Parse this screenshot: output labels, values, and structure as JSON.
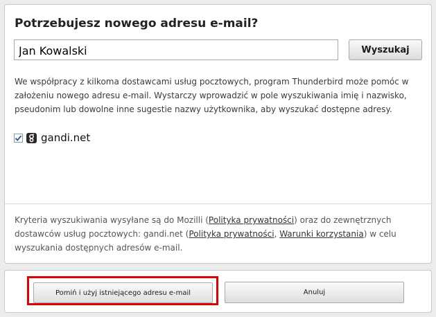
{
  "dialog": {
    "title": "Potrzebujesz nowego adresu e-mail?",
    "search": {
      "value": "Jan Kowalski",
      "button_label": "Wyszukaj"
    },
    "description": "We współpracy z kilkoma dostawcami usług pocztowych, program Thunderbird może pomóc w założeniu nowego adresu e-mail. Wystarczy wprowadzić w pole wyszukiwania imię i nazwisko, pseudonim lub dowolne inne sugestie nazwy użytkownika, aby wyszukać dostępne adresy.",
    "providers": [
      {
        "name": "gandi.net",
        "checked": true,
        "icon": "gandi-logo-icon"
      }
    ],
    "privacy": {
      "part1": "Kryteria wyszukiwania wysyłane są do Mozilli (",
      "mozilla_privacy_link": "Polityka prywatności",
      "part2": ") oraz do zewnętrznych dostawców usług pocztowych: gandi.net (",
      "provider_privacy_link": "Polityka prywatności",
      "separator": ", ",
      "provider_terms_link": "Warunki korzystania",
      "part3": ") w celu wyszukania dostępnych adresów e-mail."
    },
    "buttons": {
      "skip_label": "Pomiń i użyj istniejącego adresu e-mail",
      "cancel_label": "Anuluj"
    },
    "colors": {
      "highlight": "#e10000",
      "panel_background": "#ffffff",
      "window_background": "#ececec"
    }
  }
}
